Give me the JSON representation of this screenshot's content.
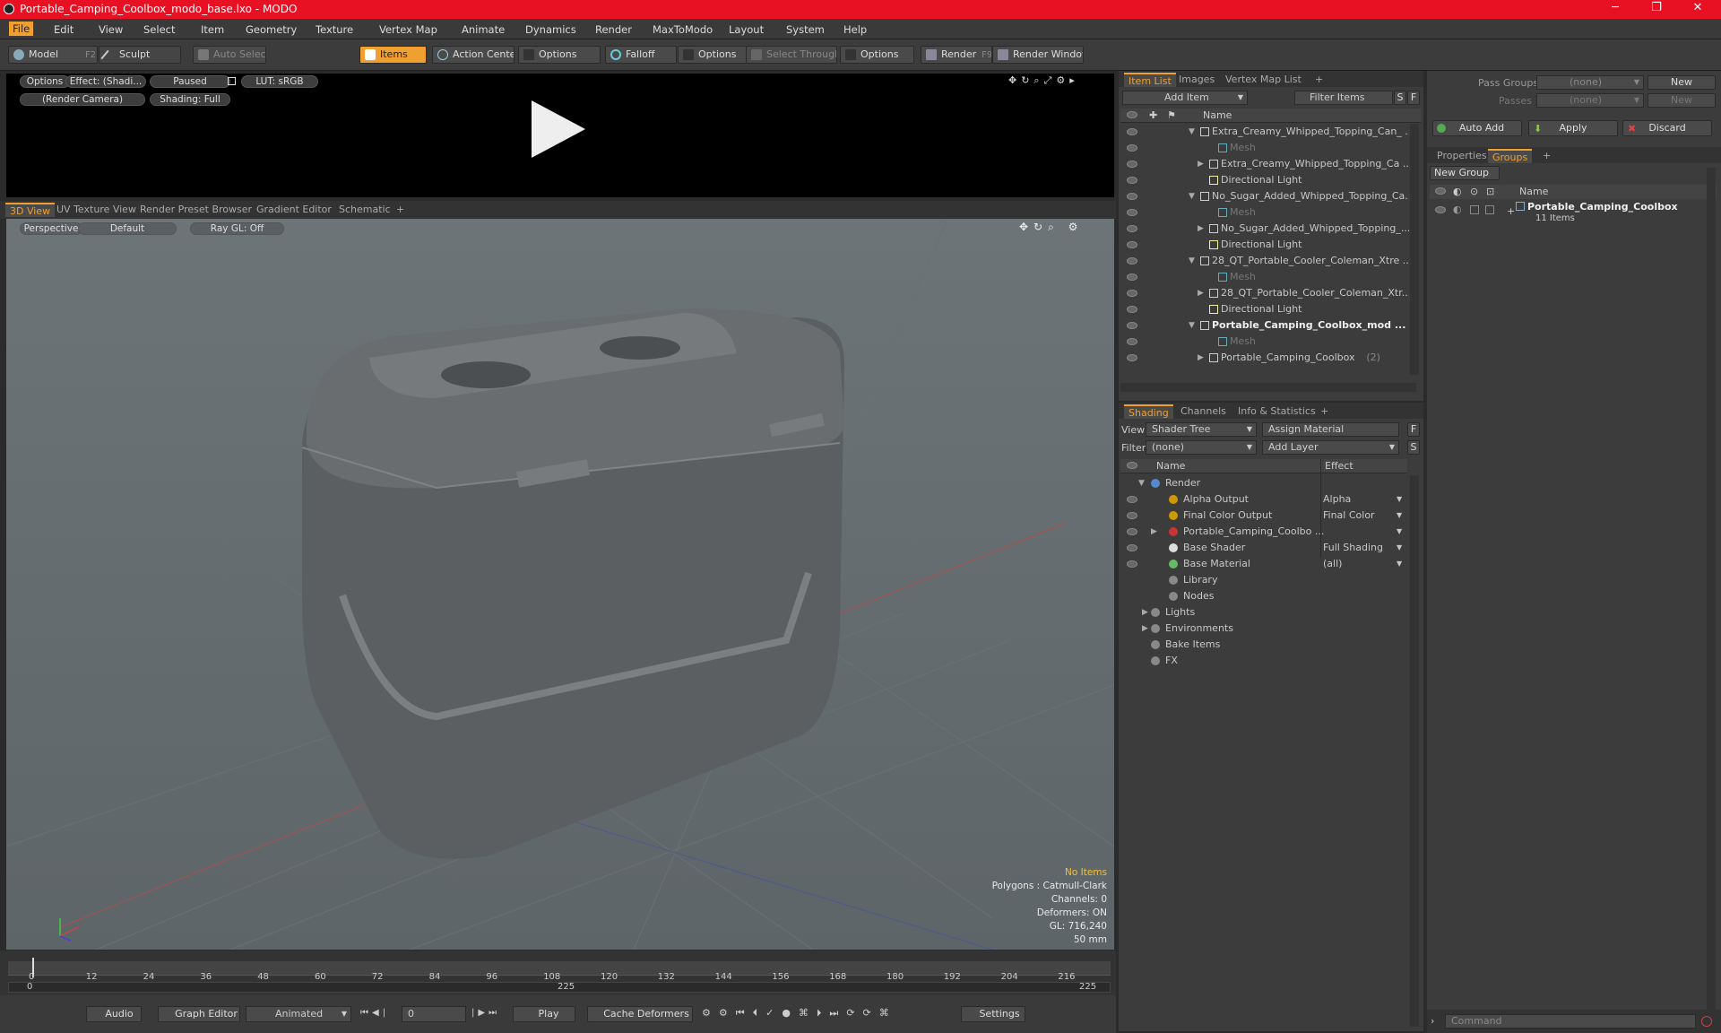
{
  "window": {
    "title": "Portable_Camping_Coolbox_modo_base.lxo - MODO",
    "minimize": "─",
    "maximize": "❐",
    "close": "✕"
  },
  "menu": [
    "File",
    "Edit",
    "View",
    "Select",
    "Item",
    "Geometry",
    "Texture",
    "Vertex Map",
    "Animate",
    "Dynamics",
    "Render",
    "MaxToModo",
    "Layout",
    "System",
    "Help"
  ],
  "toolbar": {
    "model": "Model",
    "model_key": "F2",
    "sculpt": "Sculpt",
    "auto_select": "Auto Select",
    "items": "Items",
    "action_center": "Action Center",
    "options1": "Options",
    "falloff": "Falloff",
    "options2": "Options",
    "select_through": "Select Through",
    "options3": "Options",
    "render": "Render",
    "render_key": "F9",
    "render_window": "Render Window"
  },
  "preview": {
    "options": "Options",
    "effect": "Effect: (Shadi...",
    "paused": "Paused",
    "lut": "LUT: sRGB",
    "camera": "(Render Camera)",
    "shading": "Shading: Full"
  },
  "viewport_tabs": [
    "3D View",
    "UV Texture View",
    "Render Preset Browser",
    "Gradient Editor",
    "Schematic",
    "+"
  ],
  "viewport": {
    "perspective": "Perspective",
    "default": "Default",
    "raygl": "Ray GL: Off"
  },
  "hud": {
    "no_items": "No Items",
    "polygons": "Polygons : Catmull-Clark",
    "channels": "Channels: 0",
    "deformers": "Deformers: ON",
    "gl": "GL: 716,240",
    "mm": "50 mm"
  },
  "timeline": {
    "ticks": [
      "0",
      "12",
      "24",
      "36",
      "48",
      "60",
      "72",
      "84",
      "96",
      "108",
      "120",
      "132",
      "144",
      "156",
      "168",
      "180",
      "192",
      "204",
      "216"
    ],
    "start": "0",
    "mid": "225",
    "end": "225"
  },
  "transport": {
    "audio": "Audio",
    "graph_editor": "Graph Editor",
    "animated": "Animated",
    "frame": "0",
    "play": "Play",
    "cache": "Cache Deformers",
    "settings": "Settings"
  },
  "itemlist": {
    "tabs": [
      "Item List",
      "Images",
      "Vertex Map List",
      "+"
    ],
    "add_item": "Add Item",
    "filter": "Filter Items",
    "s": "S",
    "f": "F",
    "col_name": "Name",
    "rows": [
      {
        "label": "Extra_Creamy_Whipped_Topping_Can_ ...",
        "indent": 0,
        "type": "scene",
        "expand": "▼"
      },
      {
        "label": "Mesh",
        "indent": 2,
        "type": "mesh",
        "expand": ""
      },
      {
        "label": "Extra_Creamy_Whipped_Topping_Ca ...",
        "indent": 1,
        "type": "item",
        "expand": "▶"
      },
      {
        "label": "Directional Light",
        "indent": 1,
        "type": "light",
        "expand": ""
      },
      {
        "label": "No_Sugar_Added_Whipped_Topping_Ca...",
        "indent": 0,
        "type": "scene",
        "expand": "▼"
      },
      {
        "label": "Mesh",
        "indent": 2,
        "type": "mesh",
        "expand": ""
      },
      {
        "label": "No_Sugar_Added_Whipped_Topping_...",
        "indent": 1,
        "type": "item",
        "expand": "▶"
      },
      {
        "label": "Directional Light",
        "indent": 1,
        "type": "light",
        "expand": ""
      },
      {
        "label": "28_QT_Portable_Cooler_Coleman_Xtre ...",
        "indent": 0,
        "type": "scene",
        "expand": "▼"
      },
      {
        "label": "Mesh",
        "indent": 2,
        "type": "mesh",
        "expand": ""
      },
      {
        "label": "28_QT_Portable_Cooler_Coleman_Xtr...",
        "indent": 1,
        "type": "item",
        "expand": "▶"
      },
      {
        "label": "Directional Light",
        "indent": 1,
        "type": "light",
        "expand": ""
      },
      {
        "label": "Portable_Camping_Coolbox_mod ...",
        "indent": 0,
        "type": "scene",
        "expand": "▼",
        "bold": true
      },
      {
        "label": "Mesh",
        "indent": 2,
        "type": "mesh",
        "expand": ""
      },
      {
        "label": "Portable_Camping_Coolbox",
        "count": "(2)",
        "indent": 1,
        "type": "item",
        "expand": "▶"
      }
    ]
  },
  "shading": {
    "tabs": [
      "Shading",
      "Channels",
      "Info & Statistics",
      "+"
    ],
    "view_label": "View",
    "view_value": "Shader Tree",
    "assign": "Assign Material",
    "filter_label": "Filter",
    "filter_value": "(none)",
    "add_layer": "Add Layer",
    "col_name": "Name",
    "col_effect": "Effect",
    "rows": [
      {
        "label": "Render",
        "effect": "",
        "indent": 0,
        "expand": "▼",
        "eye": false
      },
      {
        "label": "Alpha Output",
        "effect": "Alpha",
        "indent": 1,
        "expand": "",
        "eye": true
      },
      {
        "label": "Final Color Output",
        "effect": "Final Color",
        "indent": 1,
        "expand": "",
        "eye": true
      },
      {
        "label": "Portable_Camping_Coolbo ...",
        "effect": "",
        "indent": 1,
        "expand": "▶",
        "eye": true
      },
      {
        "label": "Base Shader",
        "effect": "Full Shading",
        "indent": 1,
        "expand": "",
        "eye": true
      },
      {
        "label": "Base Material",
        "effect": "(all)",
        "indent": 1,
        "expand": "",
        "eye": true
      },
      {
        "label": "Library",
        "effect": "",
        "indent": 1,
        "expand": "",
        "eye": false
      },
      {
        "label": "Nodes",
        "effect": "",
        "indent": 1,
        "expand": "",
        "eye": false
      },
      {
        "label": "Lights",
        "effect": "",
        "indent": 0,
        "expand": "▶",
        "eye": false
      },
      {
        "label": "Environments",
        "effect": "",
        "indent": 0,
        "expand": "▶",
        "eye": false
      },
      {
        "label": "Bake Items",
        "effect": "",
        "indent": 0,
        "expand": "",
        "eye": false
      },
      {
        "label": "FX",
        "effect": "",
        "indent": 0,
        "expand": "",
        "eye": false
      }
    ]
  },
  "groups": {
    "pass_groups": "Pass Groups",
    "pass_val": "(none)",
    "new": "New",
    "passes": "Passes",
    "passes_val": "(none)",
    "new2": "New",
    "auto_add": "Auto Add",
    "apply": "Apply",
    "discard": "Discard",
    "tabs": [
      "Properties",
      "Groups",
      "+"
    ],
    "new_group": "New Group",
    "col_name": "Name",
    "group_name": "Portable_Camping_Coolbox",
    "group_items": "11 Items",
    "command": "Command"
  }
}
